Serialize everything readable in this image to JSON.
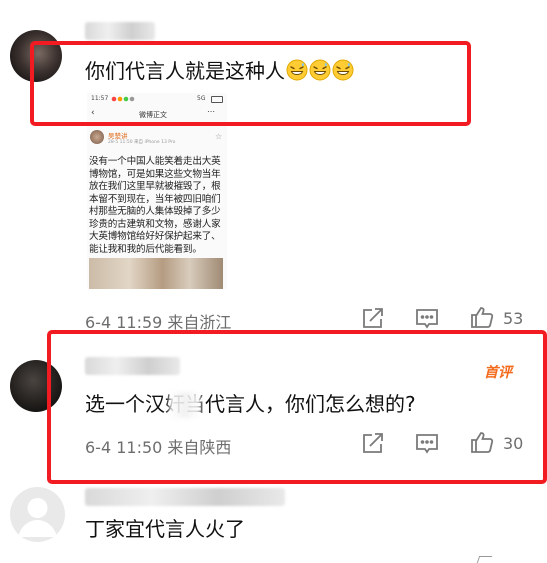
{
  "comments": [
    {
      "text": "你们代言人就是这种人",
      "emoji_count": 3,
      "emoji_name": "grinning-sweat-emoji",
      "time": "6-4 11:59",
      "location": "来自浙江",
      "likes": "53",
      "embed": {
        "status_time": "11:57",
        "status_signal": "5G",
        "header_title": "微博正文",
        "author_name": "吴楚讲",
        "post_meta": "28-5 11:50  来自 iPhone 13 Pro",
        "body_lines": [
          "没有一个中国人能笑着走出大英",
          "博物馆，可是如果这些文物当年",
          "放在我们这里早就被摧毁了，根",
          "本留不到现在，当年被四旧咱们",
          "村那些无脑的人集体毁掉了多少",
          "珍贵的古建筑和文物，感谢人家",
          "大英博物馆给好好保护起来了、",
          "能让我和我的后代能看到。"
        ]
      }
    },
    {
      "text": "选一个汉奸当代言人，你们怎么想的?",
      "badge": "首评",
      "time": "6-4 11:50",
      "location": "来自陕西",
      "likes": "30"
    },
    {
      "text": "丁家宜代言人火了"
    }
  ],
  "colors": {
    "highlight_box": "#f31b22",
    "badge": "#f36b1c",
    "meta_text": "#6e6e6e"
  }
}
